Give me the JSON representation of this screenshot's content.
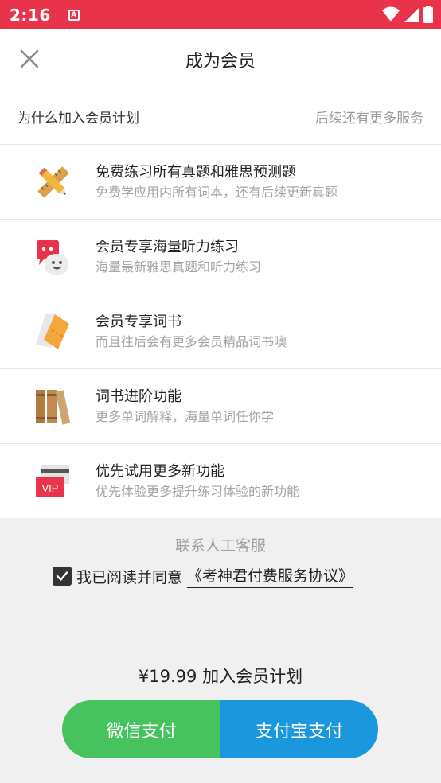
{
  "status_bar": {
    "time": "2:16",
    "notif_icon_label": "A",
    "colors": {
      "background": "#e8334a"
    }
  },
  "header": {
    "title": "成为会员",
    "close_icon": "close-icon"
  },
  "section": {
    "title": "为什么加入会员计划",
    "more": "后续还有更多服务"
  },
  "features": [
    {
      "icon": "pencil-ruler-icon",
      "title": "免费练习所有真题和雅思预测题",
      "subtitle": "免费学应用内所有词本，还有后续更新真题"
    },
    {
      "icon": "chat-faces-icon",
      "title": "会员专享海量听力练习",
      "subtitle": "海量最新雅思真题和听力练习"
    },
    {
      "icon": "ticket-icon",
      "title": "会员专享词书",
      "subtitle": "而且往后会有更多会员精品词书噢"
    },
    {
      "icon": "books-icon",
      "title": "词书进阶功能",
      "subtitle": "更多单词解释，海量单词任你学"
    },
    {
      "icon": "vip-card-icon",
      "title": "优先试用更多新功能",
      "subtitle": "优先体验更多提升练习体验的新功能"
    }
  ],
  "bottom": {
    "contact": "联系人工客服",
    "agree_checked": true,
    "agree_text": "我已阅读并同意",
    "agree_link": "《考神君付费服务协议》",
    "price": "¥19.99 加入会员计划",
    "wechat_pay": "微信支付",
    "alipay": "支付宝支付",
    "colors": {
      "wechat": "#46c35f",
      "alipay": "#1a97dd",
      "panel": "#f0f0f0"
    }
  }
}
